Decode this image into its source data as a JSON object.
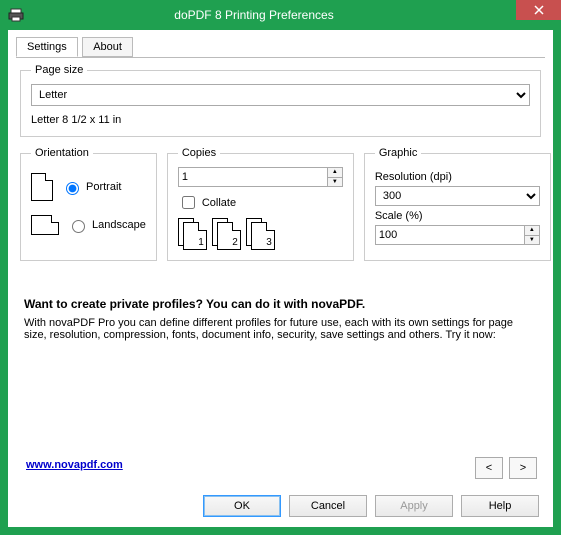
{
  "window": {
    "title": "doPDF 8 Printing Preferences"
  },
  "tabs": {
    "settings": "Settings",
    "about": "About"
  },
  "page_size": {
    "legend": "Page size",
    "selected": "Letter",
    "dimensions": "Letter 8 1/2 x 11 in"
  },
  "orientation": {
    "legend": "Orientation",
    "portrait": "Portrait",
    "landscape": "Landscape",
    "value": "portrait"
  },
  "copies": {
    "legend": "Copies",
    "count": "1",
    "collate": "Collate"
  },
  "graphic": {
    "legend": "Graphic",
    "resolution_label": "Resolution (dpi)",
    "resolution": "300",
    "scale_label": "Scale (%)",
    "scale": "100"
  },
  "promo": {
    "headline": "Want to create private profiles? You can do it with novaPDF.",
    "body": "With novaPDF Pro you can define different profiles for future use, each with its own settings for page size, resolution, compression, fonts, document info, security, save settings and others. Try it now:",
    "link": "www.novapdf.com"
  },
  "nav": {
    "prev": "<",
    "next": ">"
  },
  "buttons": {
    "ok": "OK",
    "cancel": "Cancel",
    "apply": "Apply",
    "help": "Help"
  }
}
